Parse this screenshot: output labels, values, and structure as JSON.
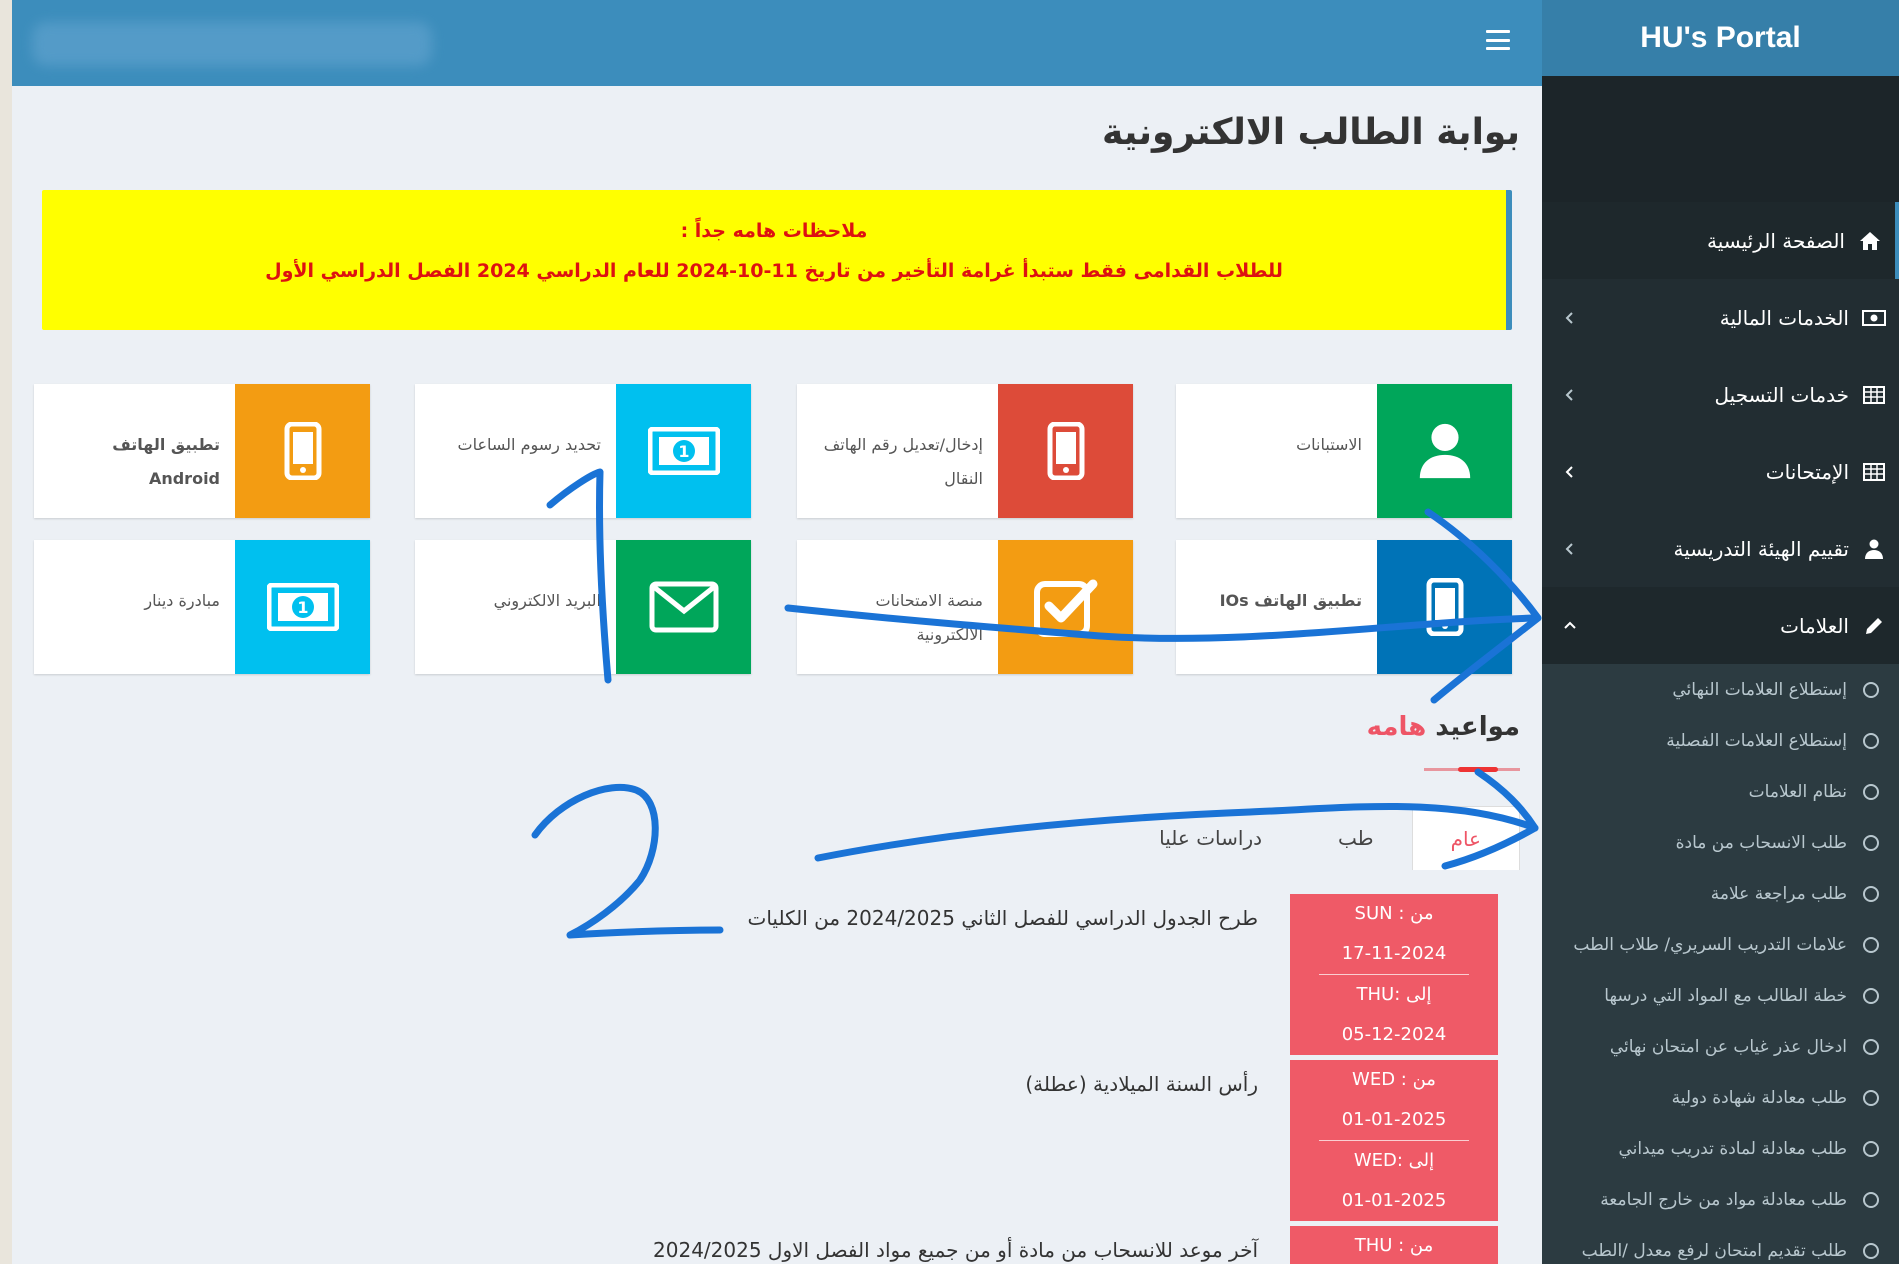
{
  "brand": "HU's Portal",
  "page_title": "بوابة الطالب الالكترونية",
  "notice": {
    "heading": "ملاحظات هامه جداً :",
    "text": "للطلاب القدامى فقط ستبدأ غرامة التأخير من تاريخ 11-10-2024 للعام الدراسي 2024 الفصل الدراسي الأول"
  },
  "boxes": [
    {
      "label": "الاستبانات",
      "icon": "user-icon",
      "color": "#00a65a"
    },
    {
      "label": "إدخال/تعديل رقم الهاتف النقال",
      "icon": "mobile-phone-icon",
      "color": "#dd4b39"
    },
    {
      "label": "تحديد رسوم الساعات",
      "icon": "money-icon",
      "color": "#00c0ef"
    },
    {
      "label": "تطبيق الهاتف Android",
      "icon": "mobile-phone-icon",
      "color": "#f39c12"
    },
    {
      "label": "تطبيق الهاتف IOs",
      "icon": "mobile-phone-icon",
      "color": "#0073b7"
    },
    {
      "label": "منصة الامتحانات الالكترونية",
      "icon": "check-square-icon",
      "color": "#f39c12"
    },
    {
      "label": "البريد الالكتروني",
      "icon": "envelope-icon",
      "color": "#00a65a"
    },
    {
      "label": "مبادرة دينار",
      "icon": "money-icon",
      "color": "#00c0ef"
    }
  ],
  "dates": {
    "title_main": "مواعيد",
    "title_accent": "هامه",
    "tabs": [
      "عام",
      "طب",
      "دراسات عليا"
    ],
    "active_tab": "عام",
    "events": [
      {
        "from_label": "من : SUN",
        "from_date": "17-11-2024",
        "to_label": "إلى :THU",
        "to_date": "05-12-2024",
        "text": "طرح الجدول الدراسي للفصل الثاني 2024/2025 من الكليات"
      },
      {
        "from_label": "من : WED",
        "from_date": "01-01-2025",
        "to_label": "إلى :WED",
        "to_date": "01-01-2025",
        "text": "رأس السنة الميلادية (عطلة)"
      },
      {
        "from_label": "من : THU",
        "text": "آخر موعد للانسحاب من مادة أو من جميع مواد الفصل الاول 2024/2025"
      }
    ]
  },
  "sidebar": {
    "items": [
      {
        "label": "الصفحة الرئيسية",
        "icon": "home-icon"
      },
      {
        "label": "الخدمات المالية",
        "icon": "money-icon"
      },
      {
        "label": "خدمات التسجيل",
        "icon": "table-icon"
      },
      {
        "label": "الإمتحانات",
        "icon": "table-icon"
      },
      {
        "label": "تقييم الهيئة التدريسية",
        "icon": "user-icon"
      },
      {
        "label": "العلامات",
        "icon": "pencil-icon"
      }
    ],
    "submenu": [
      "إستطلاع العلامات النهائي",
      "إستطلاع العلامات الفصلية",
      "نظام العلامات",
      "طلب الانسحاب من مادة",
      "طلب مراجعة علامة",
      "علامات التدريب السريري/ طلاب الطب",
      "خطة الطالب مع المواد التي درسها",
      "ادخال عذر غياب عن امتحان نهائي",
      "طلب معادلة شهادة دولية",
      "طلب معادلة لمادة تدريب ميداني",
      "طلب معادلة مواد من خارج الجامعة",
      "طلب تقديم امتحان لرفع معدل /الطب"
    ]
  },
  "annotations": [
    "1",
    "2"
  ]
}
